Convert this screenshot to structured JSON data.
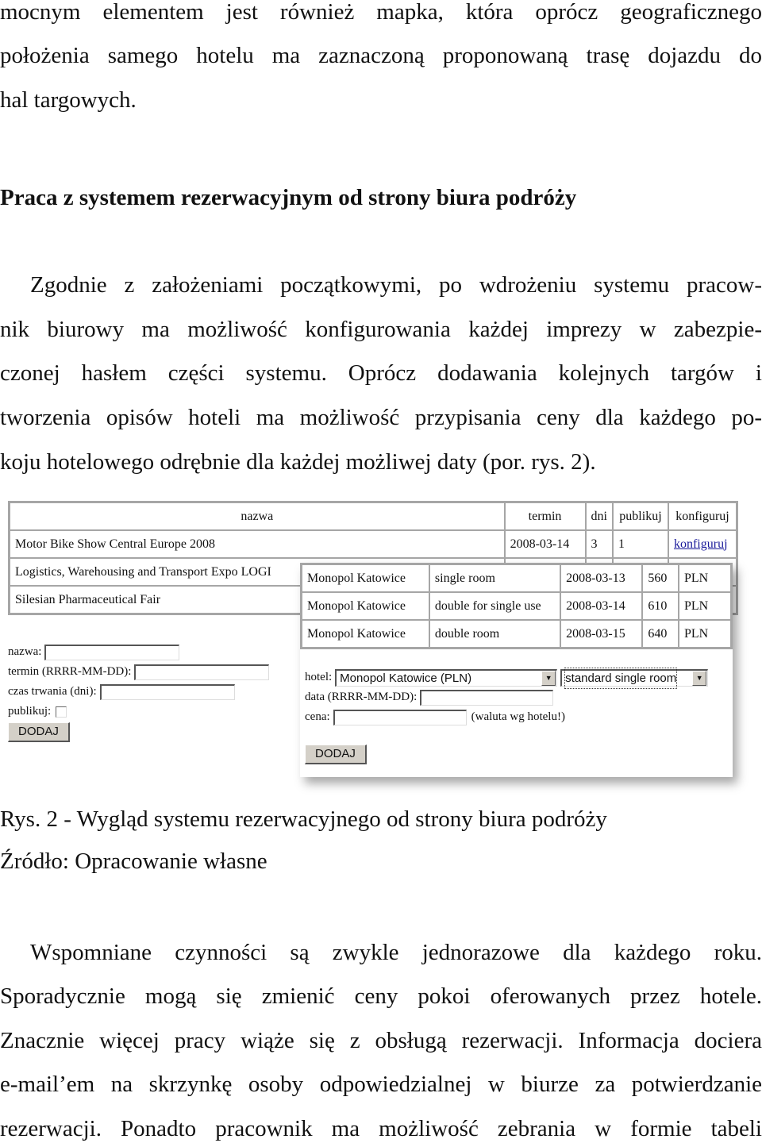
{
  "text_top": {
    "lines": [
      "mocnym elementem jest również mapka, która oprócz geograficznego",
      "położenia samego hotelu ma zaznaczoną proponowaną trasę dojazdu do",
      "hal targowych."
    ]
  },
  "section_heading": "Praca z systemem rezerwacyjnym od strony biura podróży",
  "paragraph1": {
    "lines": [
      "Zgodnie z założeniami początkowymi, po wdrożeniu systemu pracow-",
      "nik biurowy ma możliwość konfigurowania każdej imprezy w zabezpie-",
      "czonej hasłem części systemu. Oprócz dodawania kolejnych targów i",
      "tworzenia opisów hoteli ma możliwość przypisania ceny dla każdego po-",
      "koju hotelowego odrębnie dla każdej możliwej daty (por. rys. 2)."
    ]
  },
  "figure": {
    "events_table": {
      "headers": [
        "nazwa",
        "termin",
        "dni",
        "publikuj",
        "konfiguruj"
      ],
      "rows": [
        {
          "nazwa": "Motor Bike Show Central Europe 2008",
          "termin": "2008-03-14",
          "dni": "3",
          "publikuj": "1",
          "konfiguruj": "konfiguruj"
        },
        {
          "nazwa": "Logistics, Warehousing and Transport Expo LOGI",
          "termin": "",
          "dni": "",
          "publikuj": "",
          "konfiguruj": ""
        },
        {
          "nazwa": "Silesian Pharmaceutical Fair",
          "termin": "",
          "dni": "",
          "publikuj": "",
          "konfiguruj": ""
        }
      ]
    },
    "event_form": {
      "nazwa_label": "nazwa:",
      "nazwa_value": "",
      "termin_label": "termin (RRRR-MM-DD):",
      "termin_value": "",
      "czas_label": "czas trwania (dni):",
      "czas_value": "",
      "publikuj_label": "publikuj:",
      "publikuj_checked": false,
      "submit_label": "DODAJ"
    },
    "prices_table": {
      "rows": [
        [
          "Monopol Katowice",
          "single room",
          "2008-03-13",
          "560",
          "PLN"
        ],
        [
          "Monopol Katowice",
          "double for single use",
          "2008-03-14",
          "610",
          "PLN"
        ],
        [
          "Monopol Katowice",
          "double room",
          "2008-03-15",
          "640",
          "PLN"
        ]
      ]
    },
    "price_form": {
      "hotel_label": "hotel:",
      "hotel_selected": "Monopol Katowice (PLN)",
      "room_selected": "standard single room",
      "data_label": "data (RRRR-MM-DD):",
      "data_value": "",
      "cena_label": "cena:",
      "cena_value": "",
      "cena_note": "(waluta wg hotelu!)",
      "submit_label": "DODAJ"
    }
  },
  "caption": "Rys. 2 - Wygląd systemu rezerwacyjnego od strony biura podróży",
  "source": "Źródło: Opracowanie własne",
  "paragraph2": {
    "lines": [
      "Wspomniane czynności są zwykle jednorazowe dla każdego roku.",
      "Sporadycznie mogą się zmienić ceny pokoi oferowanych przez hotele.",
      "Znacznie więcej pracy wiąże się z obsługą rezerwacji. Informacja dociera",
      "e-mail’em na skrzynkę osoby odpowiedzialnej w biurze za potwierdzanie",
      "rezerwacji. Ponadto pracownik ma możliwość zebrania w formie tabeli"
    ]
  }
}
